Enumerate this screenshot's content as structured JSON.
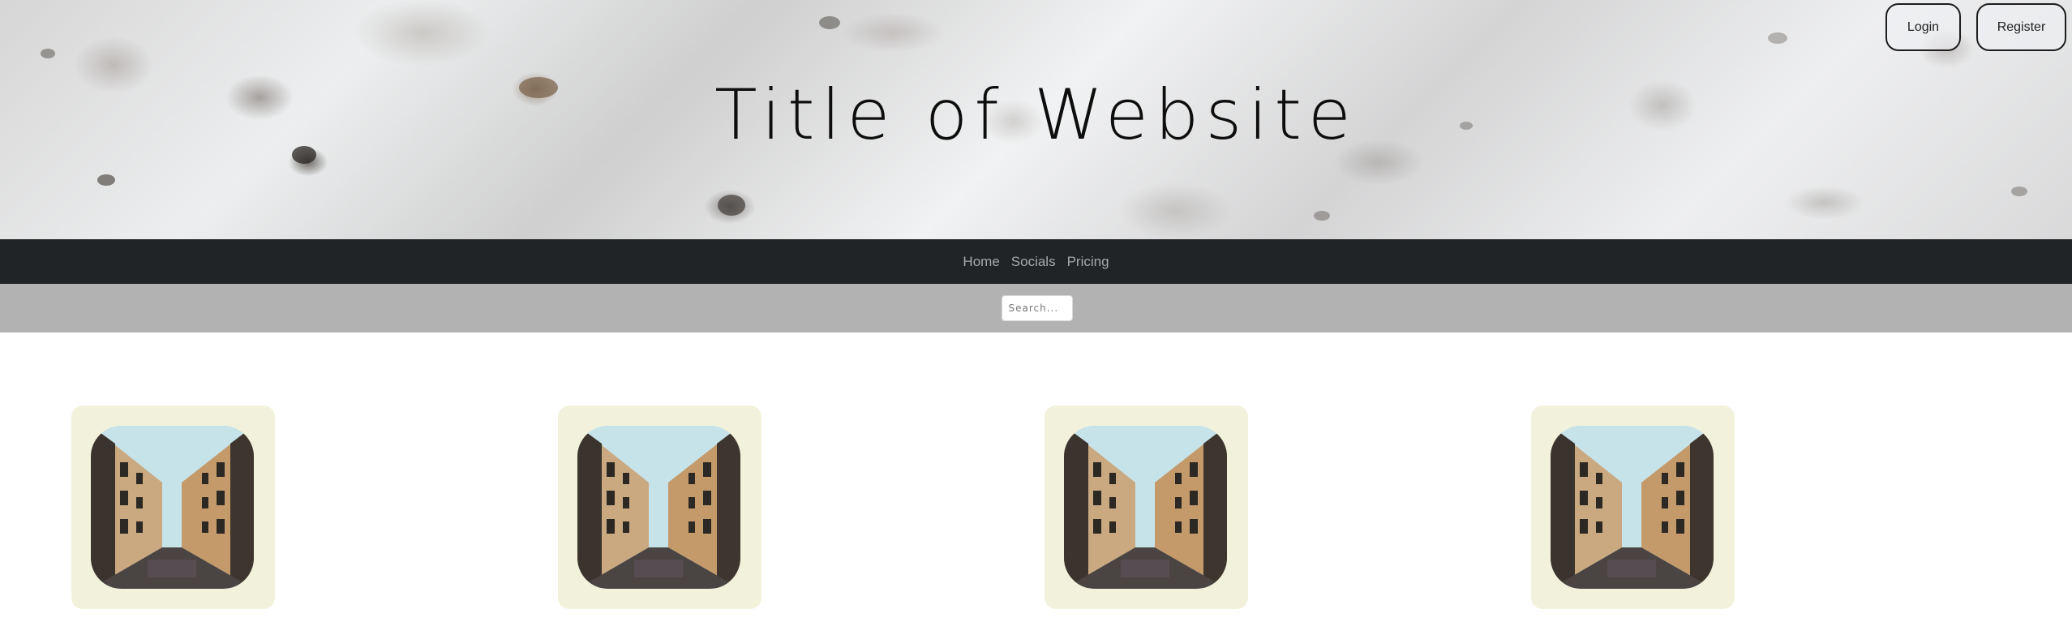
{
  "header": {
    "title": "Title of Website",
    "login_label": "Login",
    "register_label": "Register"
  },
  "nav": {
    "items": [
      {
        "label": "Home"
      },
      {
        "label": "Socials"
      },
      {
        "label": "Pricing"
      }
    ]
  },
  "search": {
    "placeholder": "Search...",
    "value": ""
  },
  "gallery": {
    "card_count": 4,
    "image_icon": "street-photo-icon"
  },
  "colors": {
    "navbar_bg": "#212427",
    "searchbar_bg": "#b2b2b2",
    "card_bg": "#f2f2dc",
    "title_text": "#0d0d0d"
  }
}
